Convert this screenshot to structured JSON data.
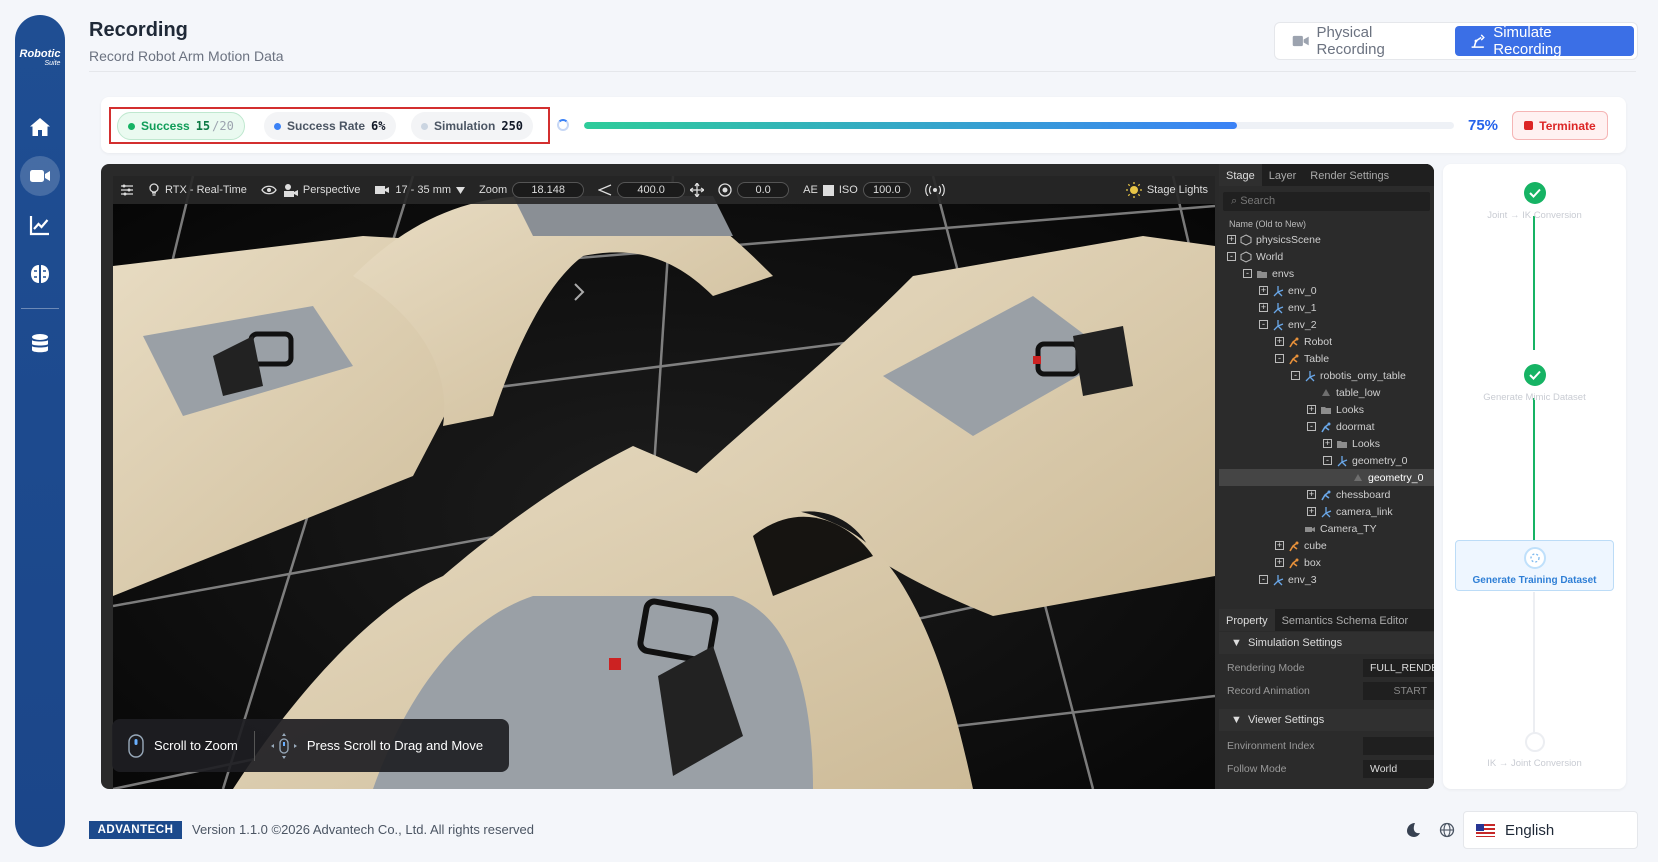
{
  "sidebar": {
    "logo": "Robotic",
    "logo_sub": "Suite",
    "items": [
      {
        "icon": "home-icon"
      },
      {
        "icon": "video-camera-icon",
        "active": true
      },
      {
        "icon": "chart-line-icon"
      },
      {
        "icon": "brain-icon"
      },
      {
        "icon": "database-icon"
      }
    ]
  },
  "header": {
    "title": "Recording",
    "subtitle": "Record Robot Arm Motion Data",
    "physical_label": "Physical Recording",
    "simulate_label": "Simulate Recording"
  },
  "status": {
    "success_label": "Success",
    "success_value": "15",
    "success_total": "/20",
    "rate_label": "Success Rate",
    "rate_value": "6%",
    "simulation_label": "Simulation",
    "simulation_value": "250",
    "progress_percent": 75,
    "progress_label": "75%",
    "terminate_label": "Terminate",
    "colors": {
      "success": "#16b364",
      "rate": "#3b82f6",
      "simulation": "#cbd5e1"
    }
  },
  "viewport": {
    "toolbar": {
      "renderer": "RTX - Real-Time",
      "camera": "Perspective",
      "lens": "17 - 35 mm",
      "zoom_label": "Zoom",
      "zoom_value": "18.148",
      "distance_value": "400.0",
      "exposure_value": "0.0",
      "ae_label": "AE",
      "iso_label": "ISO",
      "iso_value": "100.0",
      "lights_label": "Stage Lights"
    },
    "stage_tabs": [
      "Stage",
      "Layer",
      "Render Settings"
    ],
    "search_placeholder": "Search",
    "tree_header": "Name (Old to New)",
    "tree": [
      {
        "label": "physicsScene",
        "level": 0,
        "toggle": "+",
        "icon": "cube"
      },
      {
        "label": "World",
        "level": 0,
        "toggle": "-",
        "icon": "cube"
      },
      {
        "label": "envs",
        "level": 1,
        "toggle": "-",
        "icon": "folder"
      },
      {
        "label": "env_0",
        "level": 2,
        "toggle": "+",
        "icon": "xform"
      },
      {
        "label": "env_1",
        "level": 2,
        "toggle": "+",
        "icon": "xform"
      },
      {
        "label": "env_2",
        "level": 2,
        "toggle": "-",
        "icon": "xform"
      },
      {
        "label": "Robot",
        "level": 3,
        "toggle": "+",
        "icon": "articulation"
      },
      {
        "label": "Table",
        "level": 3,
        "toggle": "-",
        "icon": "articulation"
      },
      {
        "label": "robotis_omy_table",
        "level": 4,
        "toggle": "-",
        "icon": "xform"
      },
      {
        "label": "table_low",
        "level": 5,
        "toggle": "",
        "icon": "mesh"
      },
      {
        "label": "Looks",
        "level": 5,
        "toggle": "+",
        "icon": "folder"
      },
      {
        "label": "doormat",
        "level": 5,
        "toggle": "-",
        "icon": "articulation-blue"
      },
      {
        "label": "Looks",
        "level": 6,
        "toggle": "+",
        "icon": "folder"
      },
      {
        "label": "geometry_0",
        "level": 6,
        "toggle": "-",
        "icon": "xform"
      },
      {
        "label": "geometry_0",
        "level": 7,
        "toggle": "",
        "icon": "mesh",
        "selected": true
      },
      {
        "label": "chessboard",
        "level": 5,
        "toggle": "+",
        "icon": "articulation-blue"
      },
      {
        "label": "camera_link",
        "level": 5,
        "toggle": "+",
        "icon": "xform"
      },
      {
        "label": "Camera_TY",
        "level": 4,
        "toggle": "",
        "icon": "camera"
      },
      {
        "label": "cube",
        "level": 3,
        "toggle": "+",
        "icon": "articulation"
      },
      {
        "label": "box",
        "level": 3,
        "toggle": "+",
        "icon": "articulation"
      },
      {
        "label": "env_3",
        "level": 2,
        "toggle": "-",
        "icon": "xform"
      }
    ],
    "property_tabs": [
      "Property",
      "Semantics Schema Editor"
    ],
    "simulation_settings": {
      "title": "Simulation Settings",
      "rendering_mode_label": "Rendering Mode",
      "rendering_mode_value": "FULL_RENDER",
      "record_animation_label": "Record Animation",
      "record_animation_value": "START"
    },
    "viewer_settings": {
      "title": "Viewer Settings",
      "environment_index_label": "Environment Index",
      "environment_index_value": "",
      "follow_mode_label": "Follow Mode",
      "follow_mode_value": "World"
    },
    "hints": {
      "zoom": "Scroll to Zoom",
      "drag": "Press Scroll to Drag and Move"
    }
  },
  "workflow": {
    "steps": [
      {
        "label": "Joint → IK Conversion",
        "state": "done"
      },
      {
        "label": "Generate Mimic Dataset",
        "state": "done"
      },
      {
        "label": "Generate Training Dataset",
        "state": "active"
      },
      {
        "label": "IK → Joint Conversion",
        "state": "pending"
      }
    ],
    "colors": {
      "done": "#16b364",
      "active": "#2f7fd6"
    }
  },
  "footer": {
    "brand": "ADVANTECH",
    "version": "Version 1.1.0 ©2026 Advantech Co., Ltd. All rights reserved",
    "language": "English"
  }
}
